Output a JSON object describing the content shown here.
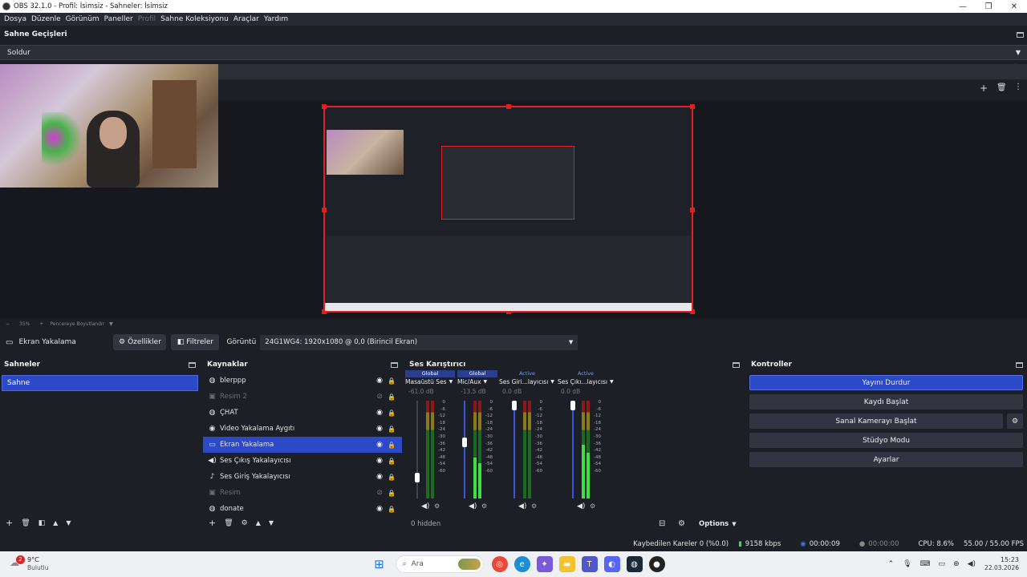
{
  "window": {
    "title": "OBS 32.1.0 - Profil: İsimsiz - Sahneler: İsimsiz",
    "min": "—",
    "max": "❐",
    "close": "✕"
  },
  "menu": [
    "Dosya",
    "Düzenle",
    "Görünüm",
    "Paneller",
    "Profil",
    "Sahne Koleksiyonu",
    "Araçlar",
    "Yardım"
  ],
  "transitions": {
    "title": "Sahne Geçişleri",
    "selected": "Soldur"
  },
  "zoom": {
    "value": "35%",
    "fit_label": "Pencereye Boyutlandır"
  },
  "source_bar": {
    "source_name": "Ekran Yakalama",
    "properties": "Özellikler",
    "filters": "Filtreler",
    "display_label": "Görüntü",
    "display_value": "24G1WG4: 1920x1080 @ 0,0 (Birincil Ekran)"
  },
  "scenes": {
    "title": "Sahneler",
    "items": [
      "Sahne"
    ]
  },
  "sources": {
    "title": "Kaynaklar",
    "items": [
      {
        "name": "blerppp",
        "icon": "globe-icon",
        "glyph": "◍",
        "visible": true,
        "dim": false
      },
      {
        "name": "Resim 2",
        "icon": "image-icon",
        "glyph": "▣",
        "visible": false,
        "dim": true
      },
      {
        "name": "ÇHAT",
        "icon": "globe-icon",
        "glyph": "◍",
        "visible": true,
        "dim": false
      },
      {
        "name": "Video Yakalama Aygıtı",
        "icon": "camera-icon",
        "glyph": "◉",
        "visible": true,
        "dim": false
      },
      {
        "name": "Ekran Yakalama",
        "icon": "monitor-icon",
        "glyph": "▭",
        "visible": true,
        "dim": false,
        "selected": true
      },
      {
        "name": "Ses Çıkış Yakalayıcısı",
        "icon": "speaker-icon",
        "glyph": "◀)",
        "visible": true,
        "dim": false
      },
      {
        "name": "Ses Giriş Yakalayıcısı",
        "icon": "microphone-icon",
        "glyph": "♪",
        "visible": true,
        "dim": false
      },
      {
        "name": "Resim",
        "icon": "image-icon",
        "glyph": "▣",
        "visible": false,
        "dim": true
      },
      {
        "name": "donate",
        "icon": "globe-icon",
        "glyph": "◍",
        "visible": true,
        "dim": false
      }
    ]
  },
  "mixer": {
    "title": "Ses Karıştırıcı",
    "hidden": "0 hidden",
    "options": "Options",
    "scale": [
      "0",
      "-6",
      "-12",
      "-18",
      "-24",
      "-30",
      "-36",
      "-42",
      "-48",
      "-54",
      "-60"
    ],
    "channels": [
      {
        "tag": "Global",
        "name": "Masaüstü Ses",
        "db": "-61.0 dB",
        "level": 0.0,
        "fader": 0.18
      },
      {
        "tag": "Global",
        "name": "Mic/Aux",
        "db": "-13.5 dB",
        "level": 0.42,
        "fader": 0.58
      },
      {
        "tag": "Active",
        "name": "Ses Giri...layıcısı",
        "db": "0.0 dB",
        "level": 0.0,
        "fader": 1.0
      },
      {
        "tag": "Active",
        "name": "Ses Çıkı...layıcısı",
        "db": "0.0 dB",
        "level": 0.55,
        "fader": 1.0
      }
    ]
  },
  "controls": {
    "title": "Kontroller",
    "buttons": [
      "Yayını Durdur",
      "Kaydı Başlat",
      "Sanal Kamerayı Başlat",
      "Stüdyo Modu",
      "Ayarlar"
    ]
  },
  "status": {
    "dropped": "Kaybedilen Kareler 0 (%0.0)",
    "bitrate": "9158 kbps",
    "stream_time": "00:00:09",
    "rec_time": "00:00:00",
    "cpu": "CPU: 8.6%",
    "fps": "55.00 / 55.00 FPS"
  },
  "taskbar": {
    "badge": "2",
    "temp": "9°C",
    "weather": "Bulutlu",
    "search": "Ara",
    "time": "15:23",
    "date": "22.03.2026"
  }
}
